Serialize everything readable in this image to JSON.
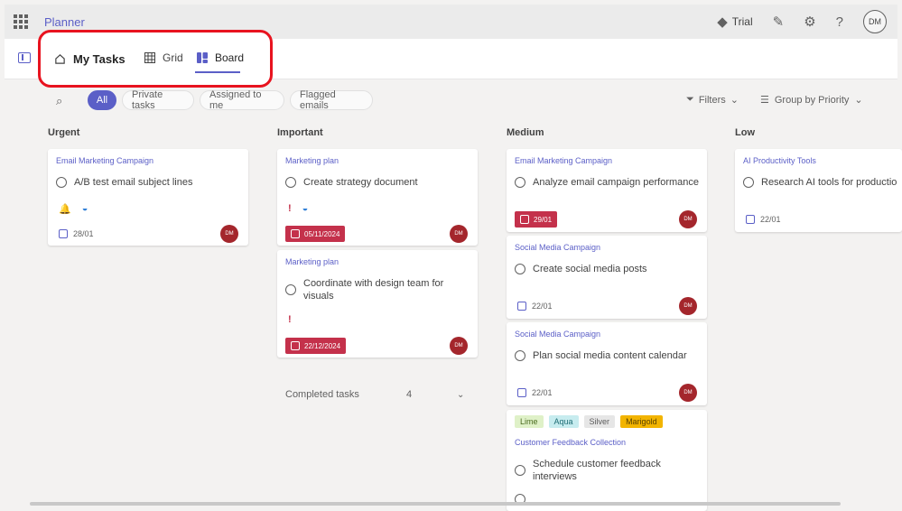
{
  "app": {
    "name": "Planner"
  },
  "topbar": {
    "trial_label": "Trial",
    "avatar_initials": "DM"
  },
  "tabs": {
    "my_tasks": "My Tasks",
    "grid": "Grid",
    "board": "Board"
  },
  "filters": {
    "chips": [
      "All",
      "Private tasks",
      "Assigned to me",
      "Flagged emails"
    ],
    "filters_label": "Filters",
    "group_by_label": "Group by Priority"
  },
  "columns": {
    "urgent": {
      "title": "Urgent",
      "cards": [
        {
          "plan": "Email Marketing Campaign",
          "task": "A/B test email subject lines",
          "date": "28/01",
          "assignee": "DM"
        }
      ]
    },
    "important": {
      "title": "Important",
      "cards": [
        {
          "plan": "Marketing plan",
          "task": "Create strategy document",
          "date": "05/11/2024",
          "assignee": "DM"
        },
        {
          "plan": "Marketing plan",
          "task": "Coordinate with design team for visuals",
          "date": "22/12/2024",
          "assignee": "DM"
        }
      ],
      "completed_label": "Completed tasks",
      "completed_count": "4"
    },
    "medium": {
      "title": "Medium",
      "cards": [
        {
          "plan": "Email Marketing Campaign",
          "task": "Analyze email campaign performance",
          "date": "29/01",
          "assignee": "DM"
        },
        {
          "plan": "Social Media Campaign",
          "task": "Create social media posts",
          "date": "22/01",
          "assignee": "DM"
        },
        {
          "plan": "Social Media Campaign",
          "task": "Plan social media content calendar",
          "date": "22/01",
          "assignee": "DM"
        },
        {
          "labels": [
            "Lime",
            "Aqua",
            "Silver",
            "Marigold"
          ],
          "plan": "Customer Feedback Collection",
          "task": "Schedule customer feedback interviews"
        }
      ]
    },
    "low": {
      "title": "Low",
      "cards": [
        {
          "plan": "AI Productivity Tools",
          "task": "Research AI tools for productio",
          "date": "22/01"
        }
      ]
    }
  },
  "colors": {
    "accent": "#5b5fc7",
    "highlight": "#e8131f",
    "overdue": "#c4314b",
    "assignee": "#a4262c"
  }
}
